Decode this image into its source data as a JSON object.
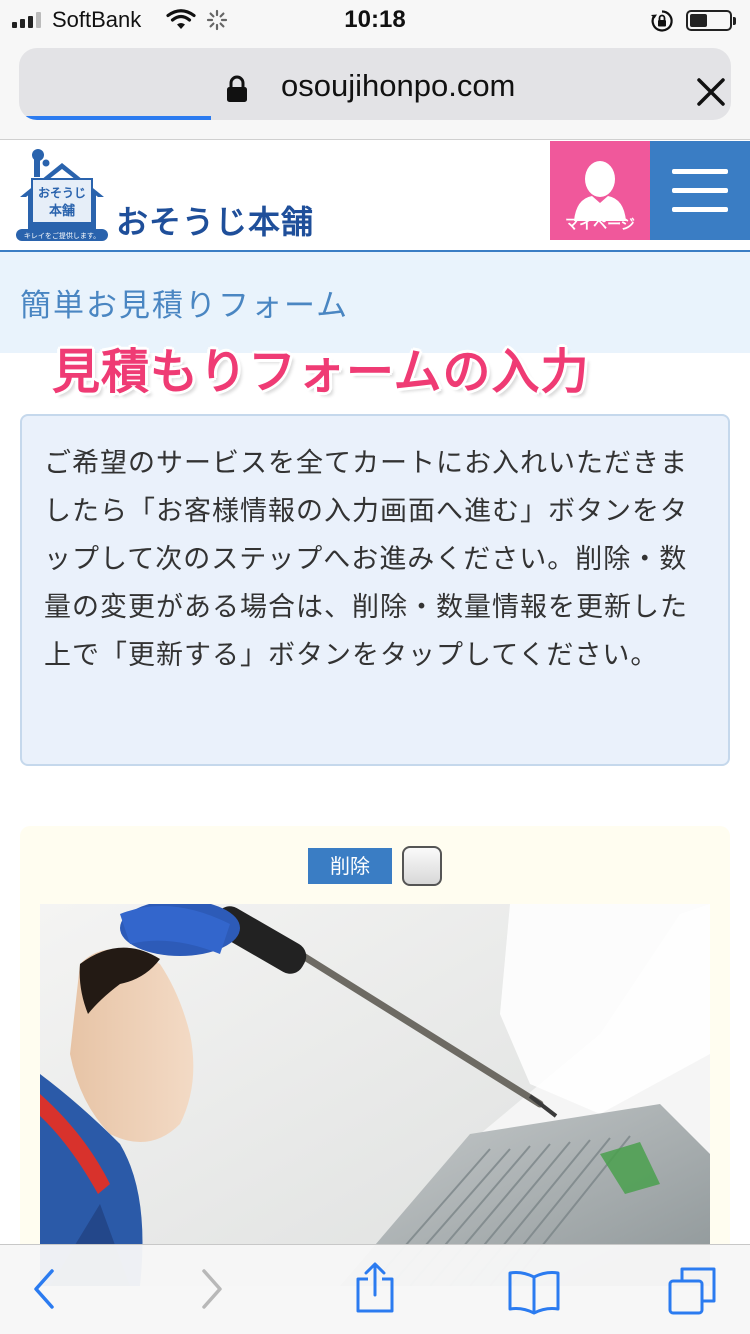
{
  "status_bar": {
    "carrier": "SoftBank",
    "time": "10:18",
    "battery_level": 0.45
  },
  "browser": {
    "url": "osoujihonpo.com",
    "load_progress": 0.27,
    "icons": [
      "lock-icon",
      "close-icon"
    ]
  },
  "site_header": {
    "logo_text": "おそうじ本舗",
    "logo_house_text_line1": "おそうじ",
    "logo_house_text_line2": "本舗",
    "logo_tagline": "キレイをご提供します。",
    "mypage_label": "マイページ",
    "colors": {
      "mypage": "#f0589b",
      "menu": "#3a7dc4"
    }
  },
  "page": {
    "title": "簡単お見積りフォーム",
    "overlay_caption": "見積もりフォームの入力",
    "info_text": "ご希望のサービスを全てカートにお入れいただきましたら「お客様情報の入力画面へ進む」ボタンをタップして次のステップへお進みください。削除・数量の変更がある場合は、削除・数量情報を更新した上で「更新する」ボタンをタップしてください。"
  },
  "cart_item": {
    "delete_label": "削除",
    "delete_checked": false
  },
  "toolbar": {
    "icons": [
      "back-icon",
      "forward-icon",
      "share-icon",
      "bookmarks-icon",
      "tabs-icon"
    ],
    "forward_enabled": false
  }
}
